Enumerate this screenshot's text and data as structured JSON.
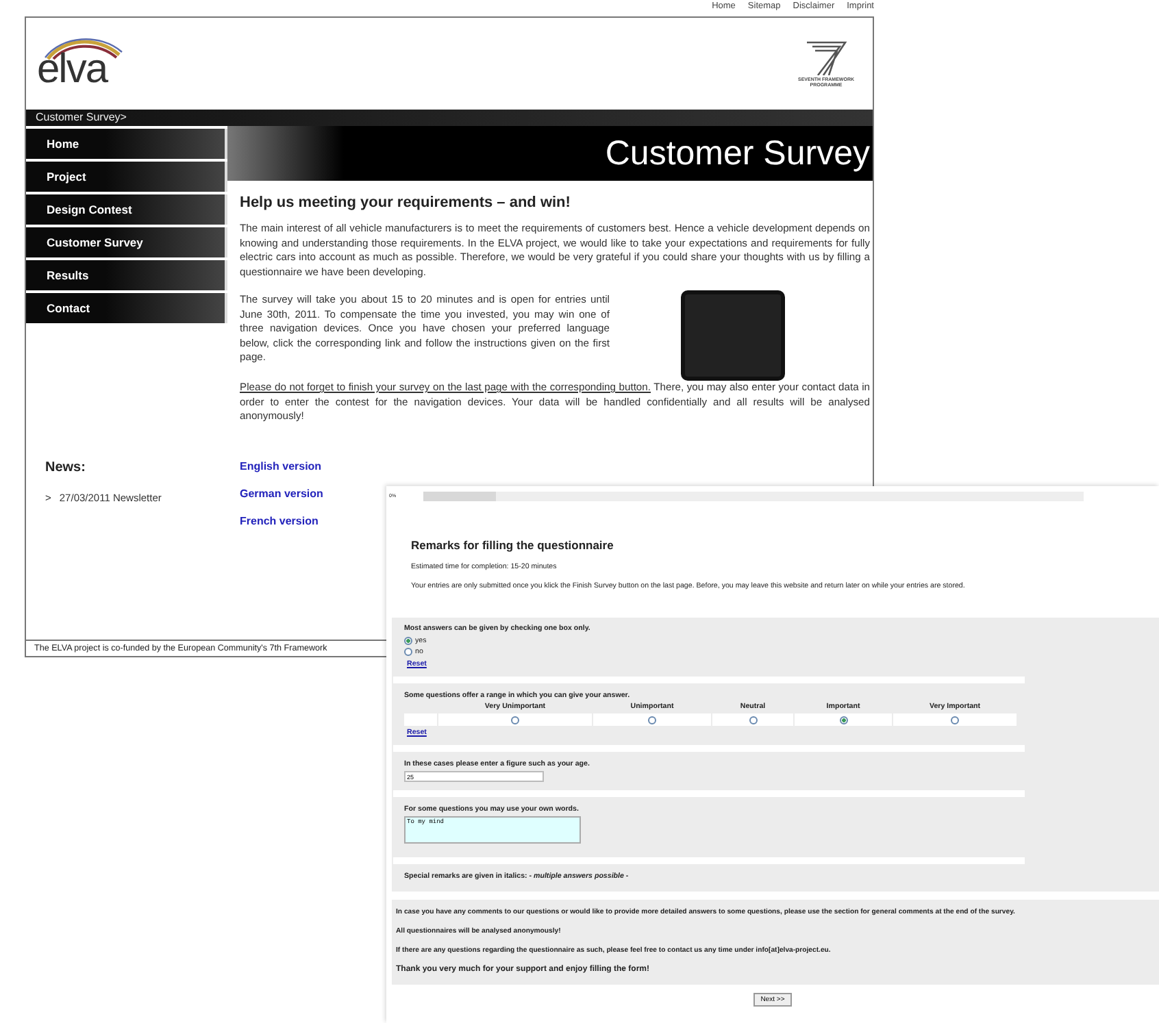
{
  "top_links": [
    "Home",
    "Sitemap",
    "Disclaimer",
    "Imprint"
  ],
  "website": {
    "logo_text": "elva",
    "fp7_logo_text": "SEVENTH FRAMEWORK PROGRAMME",
    "breadcrumb": "Customer Survey>",
    "nav": [
      "Home",
      "Project",
      "Design Contest",
      "Customer Survey",
      "Results",
      "Contact"
    ],
    "banner": "Customer Survey",
    "heading": "Help us meeting your requirements – and win!",
    "intro": "The main interest of all vehicle manufacturers is to meet the requirements of customers best. Hence a vehicle development depends on knowing and understanding those requirements. In the ELVA project, we would like to take your expectations and requirements for fully electric cars into account as much as possible. Therefore, we would be very grateful if you could share your thoughts with us by filling a questionnaire we have been developing.",
    "survey_text": "The survey will take you about 15 to 20 minutes and is open for entries until June 30th, 2011. To compensate the time you invested, you may win one of three navigation devices. Once you have chosen your preferred language below, click the corresponding link and follow the instructions given on the first page.",
    "reminder": {
      "underlined": "Please do not forget to finish your survey on the last page with the corresponding button.",
      "text": "There, you may also enter your contact data in order to enter the contest for the navigation devices. Your data will be handled confidentially and all results will be analysed anonymously!"
    },
    "news_title": "News:",
    "news": [
      {
        "marker": ">",
        "text": "27/03/2011 Newsletter"
      }
    ],
    "language_links": [
      "English version",
      "German version",
      "French version"
    ],
    "footer": "The ELVA project is co-funded by the European Community's 7th Framework"
  },
  "questionnaire": {
    "progress": {
      "label": "0%",
      "level": 0.11
    },
    "title": "Remarks for filling the questionnaire",
    "estimated": "Estimated time for completion: 15-20 minutes",
    "note": "Your entries are only submitted once you klick the Finish Survey button on the last page. Before, you may leave this website and return later on while your entries are stored.",
    "examples": [
      {
        "kind": "radio",
        "question": "Most answers can be given by checking one box only.",
        "options": [
          {
            "label": "yes",
            "selected": true
          },
          {
            "label": "no",
            "selected": false
          }
        ],
        "reset": "Reset"
      },
      {
        "kind": "scale",
        "question": "Some questions offer a range in which you can give your answer.",
        "options": [
          {
            "label": "Very Unimportant",
            "selected": false
          },
          {
            "label": "Unimportant",
            "selected": false
          },
          {
            "label": "Neutral",
            "selected": false
          },
          {
            "label": "Important",
            "selected": true
          },
          {
            "label": "Very Important",
            "selected": false
          }
        ],
        "reset": "Reset"
      },
      {
        "kind": "number",
        "question": "In these cases please enter a figure such as your age.",
        "value": "25"
      },
      {
        "kind": "text",
        "question": "For some questions you may use your own words.",
        "value": "To my mind"
      },
      {
        "kind": "remark",
        "question": "Special remarks are given in italics: - *multiple answers possible* -"
      }
    ],
    "closing": [
      "In case you have any comments to our questions or would like to provide more detailed answers to some questions, please use the section for general comments at the end of the survey.",
      "All questionnaires will be analysed anonymously!",
      "If there are any questions regarding the questionnaire as such, please feel free to contact us any time under info[at]elva-project.eu.",
      "Thank you very much for your support and enjoy filling the form!"
    ],
    "next_button": "Next >>"
  }
}
